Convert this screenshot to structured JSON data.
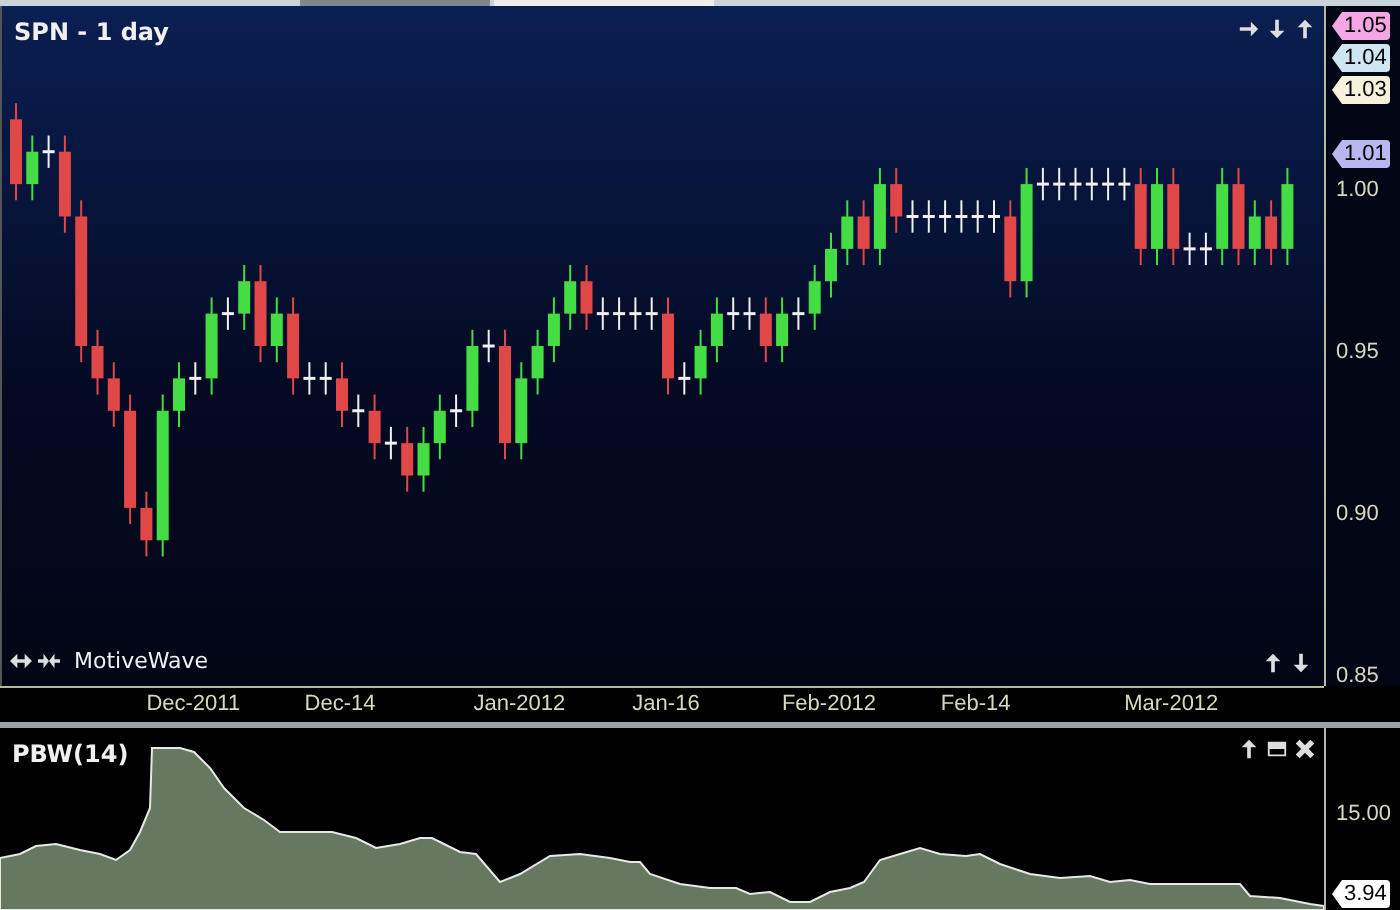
{
  "chart": {
    "title": "SPN - 1 day",
    "brand_label": "MotiveWave",
    "price_tags": [
      {
        "text": "1.05",
        "color": "#f5a6e6"
      },
      {
        "text": "1.04",
        "color": "#cde6f2"
      },
      {
        "text": "1.03",
        "color": "#f6f2dc"
      },
      {
        "text": "1.01",
        "color": "#b8b8f0"
      }
    ],
    "chart_data": {
      "type": "candlestick",
      "categories": [
        null,
        null,
        null,
        null,
        null,
        null,
        null,
        null,
        null,
        null,
        null,
        "Dec-2011",
        null,
        null,
        null,
        null,
        null,
        null,
        null,
        null,
        "Dec-14",
        null,
        null,
        null,
        null,
        null,
        null,
        null,
        null,
        null,
        null,
        "Jan-2012",
        null,
        null,
        null,
        null,
        null,
        null,
        null,
        null,
        "Jan-16",
        null,
        null,
        null,
        null,
        null,
        null,
        null,
        null,
        null,
        "Feb-2012",
        null,
        null,
        null,
        null,
        null,
        null,
        null,
        null,
        "Feb-14",
        null,
        null,
        null,
        null,
        null,
        null,
        null,
        null,
        null,
        null,
        null,
        "Mar-2012",
        null,
        null,
        null,
        null,
        null,
        null,
        null
      ],
      "ylim": [
        0.845,
        1.055
      ],
      "ohlc": [
        [
          1.02,
          1.025,
          0.995,
          1.0
        ],
        [
          1.0,
          1.015,
          0.995,
          1.01
        ],
        [
          1.01,
          1.015,
          1.005,
          1.01
        ],
        [
          1.01,
          1.015,
          0.985,
          0.99
        ],
        [
          0.99,
          0.995,
          0.945,
          0.95
        ],
        [
          0.95,
          0.955,
          0.935,
          0.94
        ],
        [
          0.94,
          0.945,
          0.925,
          0.93
        ],
        [
          0.93,
          0.935,
          0.895,
          0.9
        ],
        [
          0.9,
          0.905,
          0.885,
          0.89
        ],
        [
          0.89,
          0.935,
          0.885,
          0.93
        ],
        [
          0.93,
          0.945,
          0.925,
          0.94
        ],
        [
          0.94,
          0.945,
          0.935,
          0.94
        ],
        [
          0.94,
          0.965,
          0.935,
          0.96
        ],
        [
          0.96,
          0.965,
          0.955,
          0.96
        ],
        [
          0.96,
          0.975,
          0.955,
          0.97
        ],
        [
          0.97,
          0.975,
          0.945,
          0.95
        ],
        [
          0.95,
          0.965,
          0.945,
          0.96
        ],
        [
          0.96,
          0.965,
          0.935,
          0.94
        ],
        [
          0.94,
          0.945,
          0.935,
          0.94
        ],
        [
          0.94,
          0.945,
          0.935,
          0.94
        ],
        [
          0.94,
          0.945,
          0.925,
          0.93
        ],
        [
          0.93,
          0.935,
          0.925,
          0.93
        ],
        [
          0.93,
          0.935,
          0.915,
          0.92
        ],
        [
          0.92,
          0.925,
          0.915,
          0.92
        ],
        [
          0.92,
          0.925,
          0.905,
          0.91
        ],
        [
          0.91,
          0.925,
          0.905,
          0.92
        ],
        [
          0.92,
          0.935,
          0.915,
          0.93
        ],
        [
          0.93,
          0.935,
          0.925,
          0.93
        ],
        [
          0.93,
          0.955,
          0.925,
          0.95
        ],
        [
          0.95,
          0.955,
          0.945,
          0.95
        ],
        [
          0.95,
          0.955,
          0.915,
          0.92
        ],
        [
          0.92,
          0.945,
          0.915,
          0.94
        ],
        [
          0.94,
          0.955,
          0.935,
          0.95
        ],
        [
          0.95,
          0.965,
          0.945,
          0.96
        ],
        [
          0.96,
          0.975,
          0.955,
          0.97
        ],
        [
          0.97,
          0.975,
          0.955,
          0.96
        ],
        [
          0.96,
          0.965,
          0.955,
          0.96
        ],
        [
          0.96,
          0.965,
          0.955,
          0.96
        ],
        [
          0.96,
          0.965,
          0.955,
          0.96
        ],
        [
          0.96,
          0.965,
          0.955,
          0.96
        ],
        [
          0.96,
          0.965,
          0.935,
          0.94
        ],
        [
          0.94,
          0.945,
          0.935,
          0.94
        ],
        [
          0.94,
          0.955,
          0.935,
          0.95
        ],
        [
          0.95,
          0.965,
          0.945,
          0.96
        ],
        [
          0.96,
          0.965,
          0.955,
          0.96
        ],
        [
          0.96,
          0.965,
          0.955,
          0.96
        ],
        [
          0.96,
          0.965,
          0.945,
          0.95
        ],
        [
          0.95,
          0.965,
          0.945,
          0.96
        ],
        [
          0.96,
          0.965,
          0.955,
          0.96
        ],
        [
          0.96,
          0.975,
          0.955,
          0.97
        ],
        [
          0.97,
          0.985,
          0.965,
          0.98
        ],
        [
          0.98,
          0.995,
          0.975,
          0.99
        ],
        [
          0.99,
          0.995,
          0.975,
          0.98
        ],
        [
          0.98,
          1.005,
          0.975,
          1.0
        ],
        [
          1.0,
          1.005,
          0.985,
          0.99
        ],
        [
          0.99,
          0.995,
          0.985,
          0.99
        ],
        [
          0.99,
          0.995,
          0.985,
          0.99
        ],
        [
          0.99,
          0.995,
          0.985,
          0.99
        ],
        [
          0.99,
          0.995,
          0.985,
          0.99
        ],
        [
          0.99,
          0.995,
          0.985,
          0.99
        ],
        [
          0.99,
          0.995,
          0.985,
          0.99
        ],
        [
          0.99,
          0.995,
          0.965,
          0.97
        ],
        [
          0.97,
          1.005,
          0.965,
          1.0
        ],
        [
          1.0,
          1.005,
          0.995,
          1.0
        ],
        [
          1.0,
          1.005,
          0.995,
          1.0
        ],
        [
          1.0,
          1.005,
          0.995,
          1.0
        ],
        [
          1.0,
          1.005,
          0.995,
          1.0
        ],
        [
          1.0,
          1.005,
          0.995,
          1.0
        ],
        [
          1.0,
          1.005,
          0.995,
          1.0
        ],
        [
          1.0,
          1.005,
          0.975,
          0.98
        ],
        [
          0.98,
          1.005,
          0.975,
          1.0
        ],
        [
          1.0,
          1.005,
          0.975,
          0.98
        ],
        [
          0.98,
          0.985,
          0.975,
          0.98
        ],
        [
          0.98,
          0.985,
          0.975,
          0.98
        ],
        [
          0.98,
          1.005,
          0.975,
          1.0
        ],
        [
          1.0,
          1.005,
          0.975,
          0.98
        ],
        [
          0.98,
          0.995,
          0.975,
          0.99
        ],
        [
          0.99,
          0.995,
          0.975,
          0.98
        ],
        [
          0.98,
          1.005,
          0.975,
          1.0
        ]
      ],
      "yticks": [
        {
          "value": 1.0,
          "label": "1.00"
        },
        {
          "value": 0.95,
          "label": "0.95"
        },
        {
          "value": 0.9,
          "label": "0.90"
        },
        {
          "value": 0.85,
          "label": "0.85"
        }
      ]
    }
  },
  "indicator": {
    "title": "PBW(14)",
    "y_ticks": [
      "15.00"
    ],
    "value_tag": "3.94"
  }
}
